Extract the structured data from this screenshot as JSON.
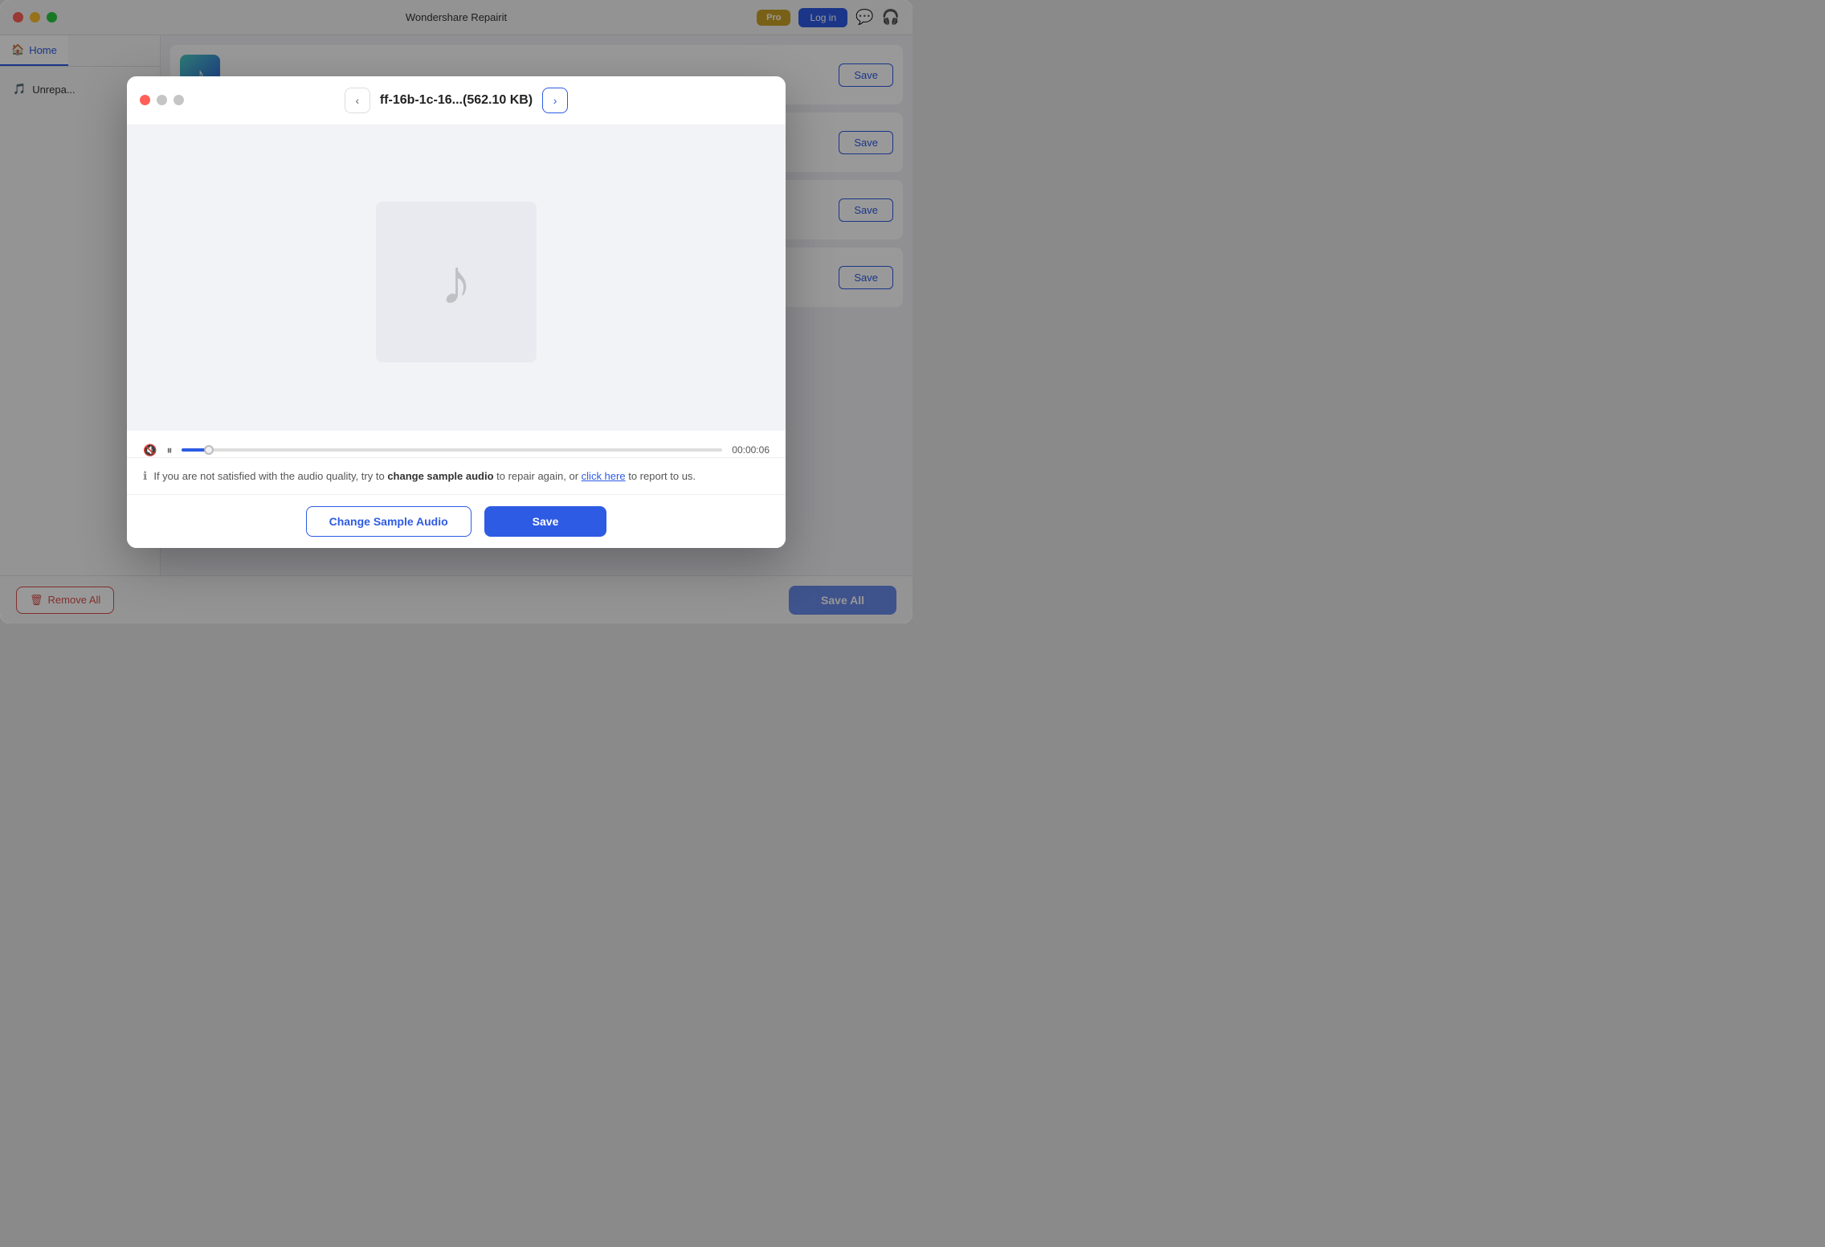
{
  "app": {
    "title": "Wondershare Repairit",
    "pro_label": "Pro",
    "login_label": "Log in"
  },
  "nav": {
    "home_label": "Home",
    "unrepairable_label": "Unrepa..."
  },
  "bottom_bar": {
    "remove_all_label": "Remove All",
    "save_all_label": "Save All"
  },
  "file_items": [
    {
      "icon_class": "blue",
      "save_label": "Save"
    },
    {
      "icon_class": "teal",
      "save_label": "Save"
    },
    {
      "icon_class": "green",
      "save_label": "Save"
    },
    {
      "icon_class": "darkblue",
      "save_label": "Save"
    }
  ],
  "modal": {
    "filename": "ff-16b-1c-16...(562.10 KB)",
    "time_elapsed": "00:00:06",
    "info_text_before": "If you are not satisfied with the audio quality, try to",
    "info_bold": "change sample audio",
    "info_text_after": "to repair again, or",
    "info_link": "click here",
    "info_text_end": "to report to us.",
    "change_sample_label": "Change Sample Audio",
    "save_label": "Save"
  }
}
